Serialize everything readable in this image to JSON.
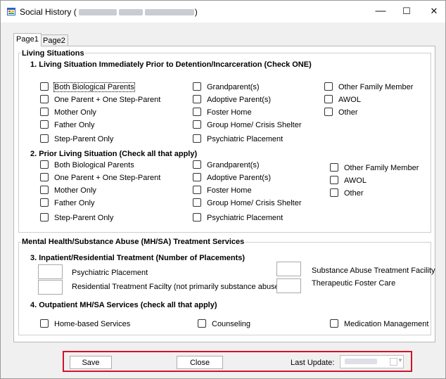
{
  "window": {
    "title_prefix": "Social History (",
    "title_hidden": "redacted client name and id",
    "title_suffix": ")",
    "minimize_glyph": "—",
    "maximize_glyph": "☐",
    "close_glyph": "✕"
  },
  "tabs": [
    {
      "label": "Page1",
      "active": true
    },
    {
      "label": "Page2",
      "active": false
    }
  ],
  "living": {
    "legend": "Living Situations",
    "q1": {
      "heading": "1. Living Situation Immediately Prior to Detention/Incarceration (Check ONE)",
      "col1": [
        "Both Biological Parents",
        "One Parent + One Step-Parent",
        "Mother Only",
        "Father Only",
        "Step-Parent Only"
      ],
      "col2": [
        "Grandparent(s)",
        "Adoptive Parent(s)",
        "Foster Home",
        "Group Home/ Crisis Shelter",
        "Psychiatric Placement"
      ],
      "col3": [
        "Other Family Member",
        "AWOL",
        "Other"
      ]
    },
    "q2": {
      "heading": "2. Prior Living Situation  (Check all that apply)",
      "col1": [
        "Both Biological Parents",
        "One Parent + One Step-Parent",
        "Mother Only",
        "Father Only",
        "Step-Parent Only"
      ],
      "col2": [
        "Grandparent(s)",
        "Adoptive Parent(s)",
        "Foster Home",
        "Group Home/ Crisis Shelter",
        "Psychiatric Placement"
      ],
      "col3": [
        "Other Family Member",
        "AWOL",
        "Other"
      ]
    }
  },
  "mhsa": {
    "legend": "Mental Health/Substance Abuse (MH/SA) Treatment Services",
    "q3": {
      "heading": "3. Inpatient/Residential Treatment (Number of Placements)",
      "psych": "Psychiatric Placement",
      "residential": "Residential Treatment Facilty (not primarily substance abuse)",
      "substance": "Substance Abuse Treatment Facility",
      "foster": "Therapeutic Foster Care"
    },
    "q4": {
      "heading": "4. Outpatient MH/SA Services (check all that apply)",
      "options": [
        "Home-based Services",
        "Counseling",
        "Medication Management"
      ]
    }
  },
  "footer": {
    "save_label": "Save",
    "close_label": "Close",
    "last_update_label": "Last Update:",
    "last_update_value": "redacted date"
  },
  "colors": {
    "highlight_border": "#d0142a"
  }
}
